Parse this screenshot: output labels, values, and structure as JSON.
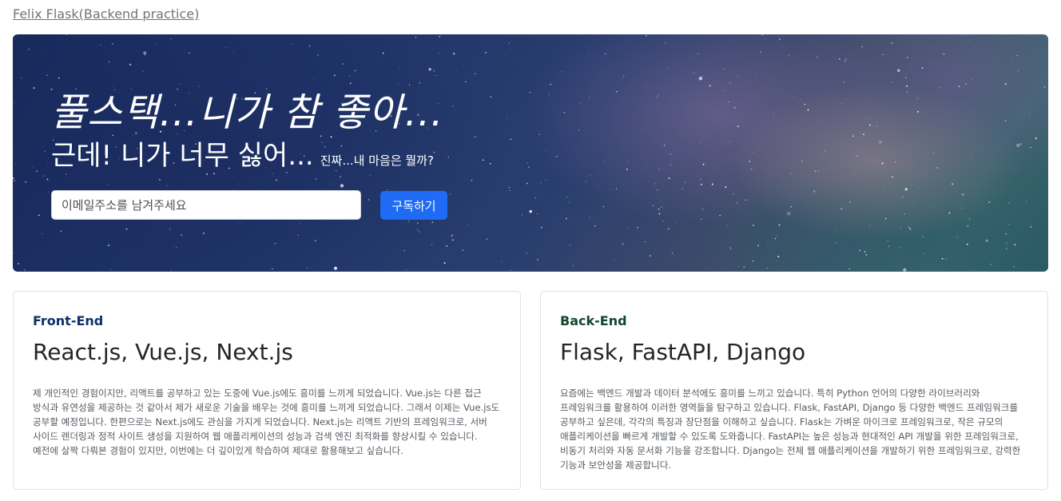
{
  "header": {
    "site_link": "Felix Flask(Backend practice)"
  },
  "hero": {
    "title": "풀스택...니가 참 좋아...",
    "subtitle": "근데! 니가 너무 싫어...",
    "subtitle_small": "진짜...내 마음은 뭘까?",
    "email_placeholder": "이메일주소를 남겨주세요",
    "subscribe_label": "구독하기"
  },
  "cards": [
    {
      "kicker": "Front-End",
      "title": "React.js, Vue.js, Next.js",
      "text": "제 개인적인 경험이지만, 리액트를 공부하고 있는 도중에 Vue.js에도 흥미를 느끼게 되었습니다. Vue.js는 다른 접근 방식과 유연성을 제공하는 것 같아서 제가 새로운 기술을 배우는 것에 흥미를 느끼게 되었습니다. 그래서 이제는 Vue.js도 공부할 예정입니다. 한편으로는 Next.js에도 관심을 가지게 되었습니다. Next.js는 리액트 기반의 프레임워크로, 서버 사이드 렌더링과 정적 사이트 생성을 지원하여 웹 애플리케이션의 성능과 검색 엔진 최적화를 향상시킬 수 있습니다. 예전에 살짝 다뤄본 경험이 있지만, 이번에는 더 깊이있게 학습하여 제대로 활용해보고 싶습니다."
    },
    {
      "kicker": "Back-End",
      "title": "Flask, FastAPI, Django",
      "text": "요즘에는 백엔드 개발과 데이터 분석에도 흥미를 느끼고 있습니다. 특히 Python 언어의 다양한 라이브러리와 프레임워크를 활용하여 이러한 영역들을 탐구하고 있습니다. Flask, FastAPI, Django 등 다양한 백엔드 프레임워크를 공부하고 싶은데, 각각의 특징과 장단점을 이해하고 싶습니다. Flask는 가벼운 마이크로 프레임워크로, 작은 규모의 애플리케이션을 빠르게 개발할 수 있도록 도와줍니다. FastAPI는 높은 성능과 현대적인 API 개발을 위한 프레임워크로, 비동기 처리와 자동 문서화 기능을 강조합니다. Django는 전체 웹 애플리케이션을 개발하기 위한 프레임워크로, 강력한 기능과 보안성을 제공합니다."
    }
  ],
  "colors": {
    "button": "#1f6bf5",
    "front_kicker": "#0d2f6b",
    "back_kicker": "#11462c"
  }
}
